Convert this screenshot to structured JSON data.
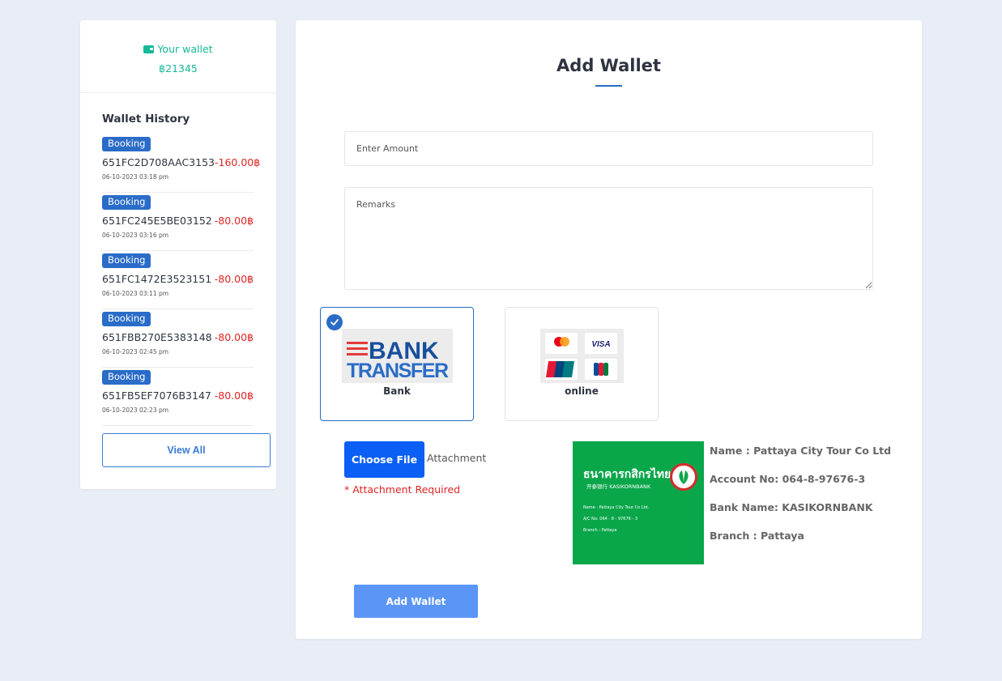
{
  "wallet": {
    "title": "Your wallet",
    "balance": "฿21345",
    "icon": "wallet-icon",
    "accent_color": "#16b998"
  },
  "history": {
    "title": "Wallet History",
    "items": [
      {
        "badge": "Booking",
        "ref": "651FC2D708AAC3153",
        "amount": "-160.00฿",
        "date": "06-10-2023 03:18 pm"
      },
      {
        "badge": "Booking",
        "ref": "651FC245E5BE03152",
        "amount": "-80.00฿",
        "date": "06-10-2023 03:16 pm"
      },
      {
        "badge": "Booking",
        "ref": "651FC1472E3523151",
        "amount": "-80.00฿",
        "date": "06-10-2023 03:11 pm"
      },
      {
        "badge": "Booking",
        "ref": "651FBB270E5383148",
        "amount": "-80.00฿",
        "date": "06-10-2023 02:45 pm"
      },
      {
        "badge": "Booking",
        "ref": "651FB5EF7076B3147",
        "amount": "-80.00฿",
        "date": "06-10-2023 02:23 pm"
      }
    ],
    "view_all_label": "View All"
  },
  "form": {
    "title": "Add Wallet",
    "amount_placeholder": "Enter Amount",
    "remarks_placeholder": "Remarks",
    "payment_methods": [
      {
        "label": "Bank",
        "image_text": [
          "BANK",
          "TRANSFER"
        ],
        "selected": true
      },
      {
        "label": "online",
        "image_text": [
          "VISA"
        ],
        "selected": false
      }
    ],
    "choose_file_label": "Choose File",
    "attachment_label": "Attachment",
    "attachment_required": "* Attachment Required",
    "submit_label": "Add Wallet",
    "primary_color": "#2a6cc7",
    "error_color": "#e02424"
  },
  "bank": {
    "card": {
      "thai_name": "ธนาคารกสิกรไทย",
      "eng_name": "开泰银行 KASIKORNBANK",
      "lines": [
        "Name : Pattaya City Tour Co Ltd.",
        "A/C No: 064 - 8 - 97676 - 3",
        "Branch : Pattaya"
      ]
    },
    "info": [
      "Name : Pattaya City Tour Co Ltd",
      "Account No: 064-8-97676-3",
      "Bank Name: KASIKORNBANK",
      "Branch : Pattaya"
    ],
    "card_color": "#0aa64a"
  }
}
